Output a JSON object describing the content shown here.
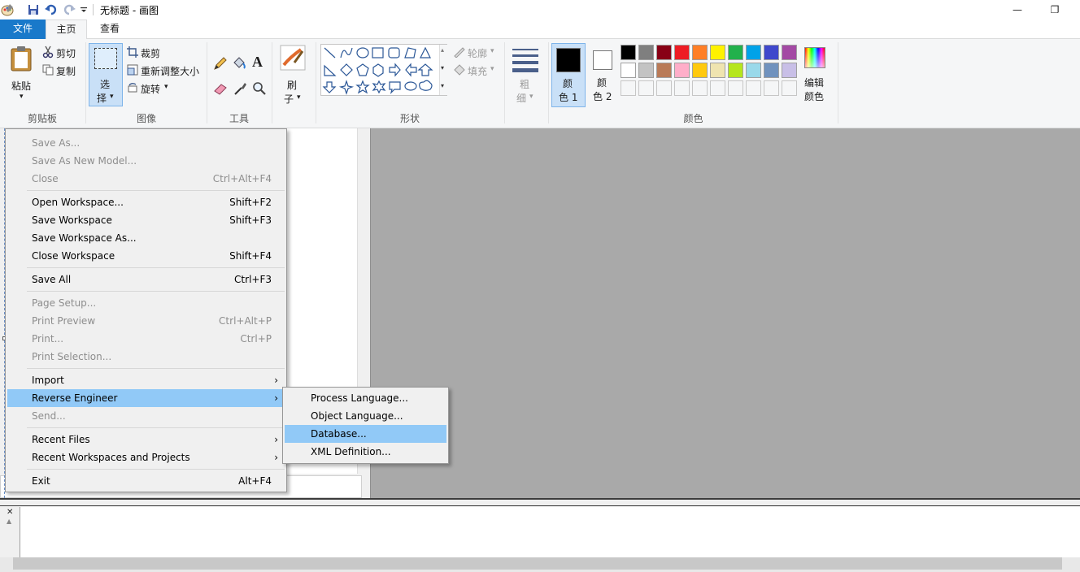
{
  "window": {
    "title": "无标题 - 画图",
    "minimize_glyph": "—",
    "restore_glyph": "❐"
  },
  "tabs": {
    "file": "文件",
    "home": "主页",
    "view": "查看"
  },
  "ribbon": {
    "clipboard": {
      "paste": "粘贴",
      "cut": "剪切",
      "copy": "复制",
      "label": "剪贴板"
    },
    "image": {
      "select_line1": "选",
      "select_line2": "择",
      "crop": "裁剪",
      "resize": "重新调整大小",
      "rotate": "旋转",
      "label": "图像"
    },
    "tools": {
      "text_glyph": "A",
      "label": "工具"
    },
    "brushes": {
      "line1": "刷",
      "line2": "子"
    },
    "shapes": {
      "outline": "轮廓",
      "fill": "填充",
      "label": "形状"
    },
    "size": {
      "line1": "粗",
      "line2": "细"
    },
    "colors": {
      "color1_line1": "颜",
      "color1_line2": "色 1",
      "color2_line1": "颜",
      "color2_line2": "色 2",
      "edit_line1": "编辑",
      "edit_line2": "颜色",
      "label": "颜色",
      "row1": [
        "#000000",
        "#7f7f7f",
        "#880015",
        "#ed1c24",
        "#ff7f27",
        "#fff200",
        "#22b14c",
        "#00a2e8",
        "#3f48cc",
        "#a349a4"
      ],
      "row2": [
        "#ffffff",
        "#c3c3c3",
        "#b97a57",
        "#ffaec9",
        "#ffc90e",
        "#efe4b0",
        "#b5e61d",
        "#99d9ea",
        "#7092be",
        "#c8bfe7"
      ]
    }
  },
  "file_menu": {
    "items": [
      {
        "label": "Save As...",
        "shortcut": "",
        "disabled": true
      },
      {
        "label": "Save As New Model...",
        "shortcut": "",
        "disabled": true
      },
      {
        "label": "Close",
        "shortcut": "Ctrl+Alt+F4",
        "disabled": true
      },
      {
        "label": "Open Workspace...",
        "shortcut": "Shift+F2"
      },
      {
        "label": "Save Workspace",
        "shortcut": "Shift+F3"
      },
      {
        "label": "Save Workspace As...",
        "shortcut": ""
      },
      {
        "label": "Close Workspace",
        "shortcut": "Shift+F4"
      },
      {
        "label": "Save All",
        "shortcut": "Ctrl+F3"
      },
      {
        "label": "Page Setup...",
        "shortcut": "",
        "disabled": true
      },
      {
        "label": "Print Preview",
        "shortcut": "Ctrl+Alt+P",
        "disabled": true
      },
      {
        "label": "Print...",
        "shortcut": "Ctrl+P",
        "disabled": true
      },
      {
        "label": "Print Selection...",
        "shortcut": "",
        "disabled": true
      },
      {
        "label": "Import",
        "shortcut": "",
        "submenu": true
      },
      {
        "label": "Reverse Engineer",
        "shortcut": "",
        "submenu": true,
        "highlighted": true
      },
      {
        "label": "Send...",
        "shortcut": "",
        "disabled": true
      },
      {
        "label": "Recent Files",
        "shortcut": "",
        "submenu": true
      },
      {
        "label": "Recent Workspaces and Projects",
        "shortcut": "",
        "submenu": true
      },
      {
        "label": "Exit",
        "shortcut": "Alt+F4"
      }
    ]
  },
  "reverse_engineer_submenu": {
    "items": [
      {
        "label": "Process Language..."
      },
      {
        "label": "Object Language..."
      },
      {
        "label": "Database...",
        "highlighted": true
      },
      {
        "label": "XML Definition..."
      }
    ]
  }
}
